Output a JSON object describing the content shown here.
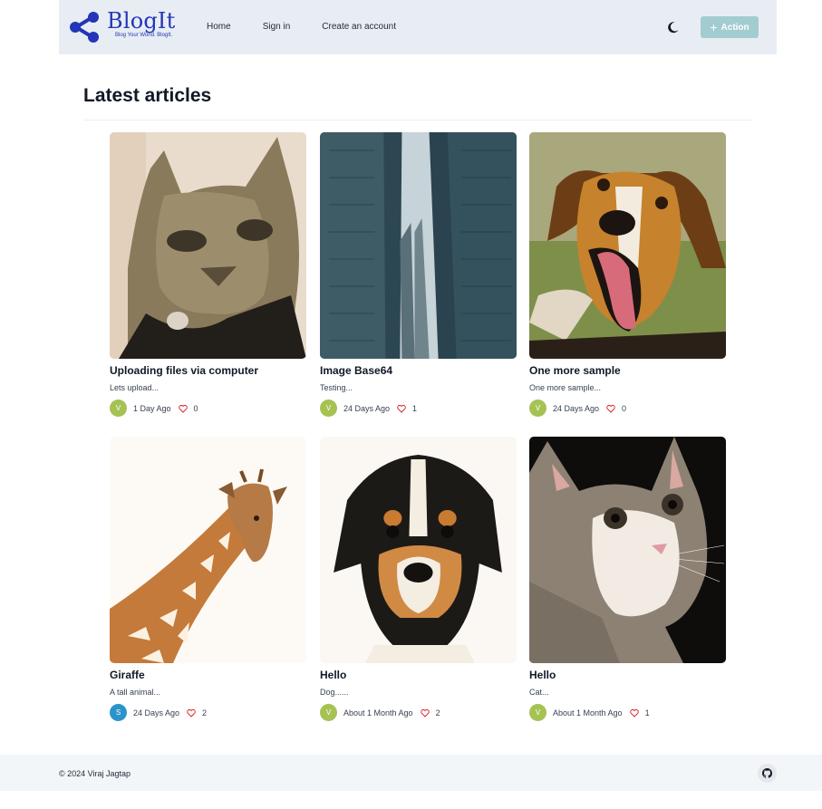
{
  "header": {
    "brand": "BlogIt",
    "tagline": "Blog Your World. BlogIt.",
    "nav": [
      "Home",
      "Sign in",
      "Create an account"
    ],
    "action_label": "Action",
    "brand_color": "#2435b8",
    "action_color": "#a3ccd1"
  },
  "main": {
    "title": "Latest articles",
    "articles": [
      {
        "title": "Uploading files via computer",
        "desc": "Lets upload...",
        "avatar": "V",
        "date": "1 Day Ago",
        "likes": "0",
        "image": "cat-photo",
        "avatar_color": "#a5c253"
      },
      {
        "title": "Image Base64",
        "desc": "Testing...",
        "avatar": "V",
        "date": "24 Days Ago",
        "likes": "1",
        "image": "skyscrapers-photo",
        "avatar_color": "#a5c253"
      },
      {
        "title": "One more sample",
        "desc": "One more sample...",
        "avatar": "V",
        "date": "24 Days Ago",
        "likes": "0",
        "image": "dog-photo",
        "avatar_color": "#a5c253"
      },
      {
        "title": "Giraffe",
        "desc": "A tall animal...",
        "avatar": "S",
        "date": "24 Days Ago",
        "likes": "2",
        "image": "giraffe-photo",
        "avatar_color": "#2b93c9"
      },
      {
        "title": "Hello",
        "desc": "Dog......",
        "avatar": "V",
        "date": "About 1 Month Ago",
        "likes": "2",
        "image": "puppy-photo",
        "avatar_color": "#a5c253"
      },
      {
        "title": "Hello",
        "desc": "Cat...",
        "avatar": "V",
        "date": "About 1 Month Ago",
        "likes": "1",
        "image": "kitten-photo",
        "avatar_color": "#a5c253"
      }
    ]
  },
  "footer": {
    "copyright": "© 2024 Viraj Jagtap",
    "icon": "github-icon"
  }
}
